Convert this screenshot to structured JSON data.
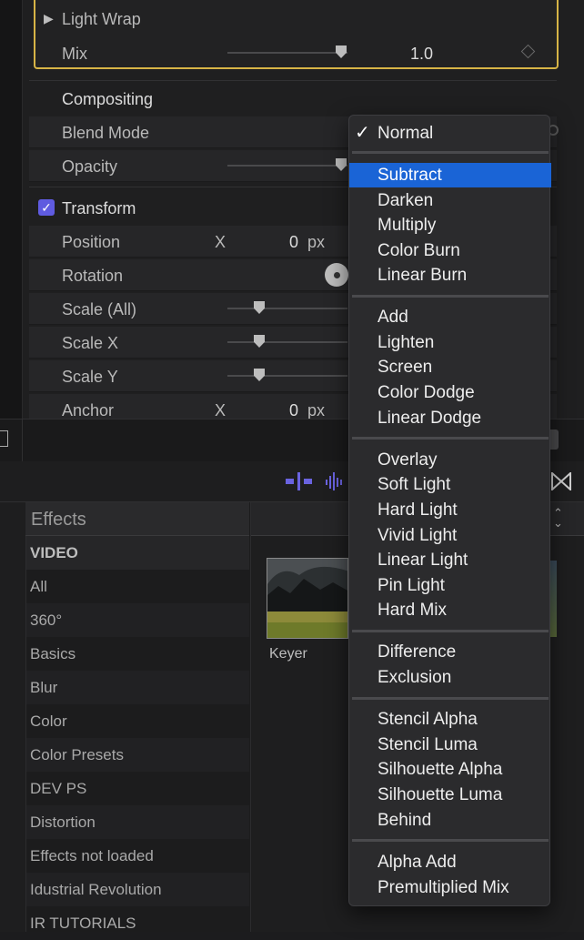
{
  "inspector": {
    "light_wrap": {
      "label": "Light Wrap",
      "mix_label": "Mix",
      "mix_value": "1.0"
    },
    "compositing": {
      "title": "Compositing",
      "blend_mode_label": "Blend Mode",
      "opacity_label": "Opacity"
    },
    "transform": {
      "title": "Transform",
      "position_label": "Position",
      "position_axis": "X",
      "position_value": "0",
      "position_unit": "px",
      "rotation_label": "Rotation",
      "scale_all_label": "Scale (All)",
      "scale_x_label": "Scale X",
      "scale_y_label": "Scale Y",
      "anchor_label": "Anchor",
      "anchor_axis": "X",
      "anchor_value": "0",
      "anchor_unit": "px"
    }
  },
  "effects": {
    "header": "Effects",
    "categories": [
      "VIDEO",
      "All",
      "360°",
      "Basics",
      "Blur",
      "Color",
      "Color Presets",
      "DEV PS",
      "Distortion",
      "Effects not loaded",
      "Idustrial Revolution",
      "IR TUTORIALS"
    ],
    "thumbnail_label": "Keyer"
  },
  "blend_menu": {
    "groups": [
      [
        "Normal"
      ],
      [
        "Subtract",
        "Darken",
        "Multiply",
        "Color Burn",
        "Linear Burn"
      ],
      [
        "Add",
        "Lighten",
        "Screen",
        "Color Dodge",
        "Linear Dodge"
      ],
      [
        "Overlay",
        "Soft Light",
        "Hard Light",
        "Vivid Light",
        "Linear Light",
        "Pin Light",
        "Hard Mix"
      ],
      [
        "Difference",
        "Exclusion"
      ],
      [
        "Stencil Alpha",
        "Stencil Luma",
        "Silhouette Alpha",
        "Silhouette Luma",
        "Behind"
      ],
      [
        "Alpha Add",
        "Premultiplied Mix"
      ]
    ],
    "checked": "Normal",
    "highlighted": "Subtract"
  },
  "colors": {
    "accent_blue": "#1a64d6",
    "highlight_gold": "#d7b446",
    "checkbox_purple": "#5f5be0"
  }
}
